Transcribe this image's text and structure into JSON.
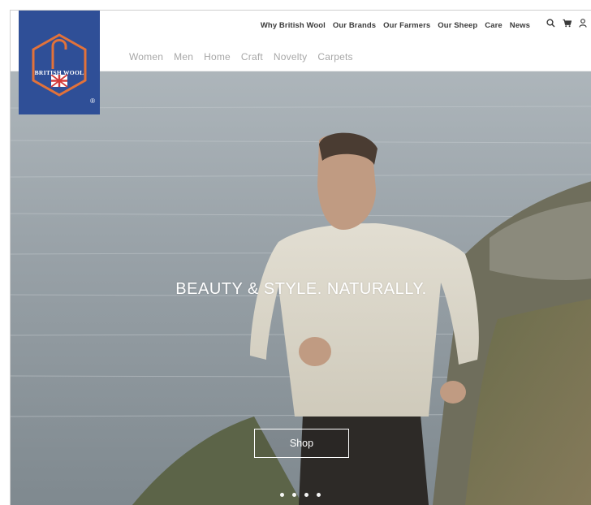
{
  "brand": {
    "logo_text": "BRITISH WOOL",
    "registered_mark": "®",
    "colors": {
      "logo_bg": "#2f4f97",
      "logo_accent": "#e2723a"
    }
  },
  "topnav": {
    "items": [
      {
        "label": "Why British Wool"
      },
      {
        "label": "Our Brands"
      },
      {
        "label": "Our Farmers"
      },
      {
        "label": "Our Sheep"
      },
      {
        "label": "Care"
      },
      {
        "label": "News"
      }
    ]
  },
  "utility": {
    "icons": [
      "search-icon",
      "cart-icon",
      "account-icon"
    ]
  },
  "catnav": {
    "items": [
      {
        "label": "Women"
      },
      {
        "label": "Men"
      },
      {
        "label": "Home"
      },
      {
        "label": "Craft"
      },
      {
        "label": "Novelty"
      },
      {
        "label": "Carpets"
      }
    ]
  },
  "hero": {
    "headline": "BEAUTY & STYLE. NATURALLY.",
    "cta_label": "Shop",
    "slides_count": 4
  }
}
